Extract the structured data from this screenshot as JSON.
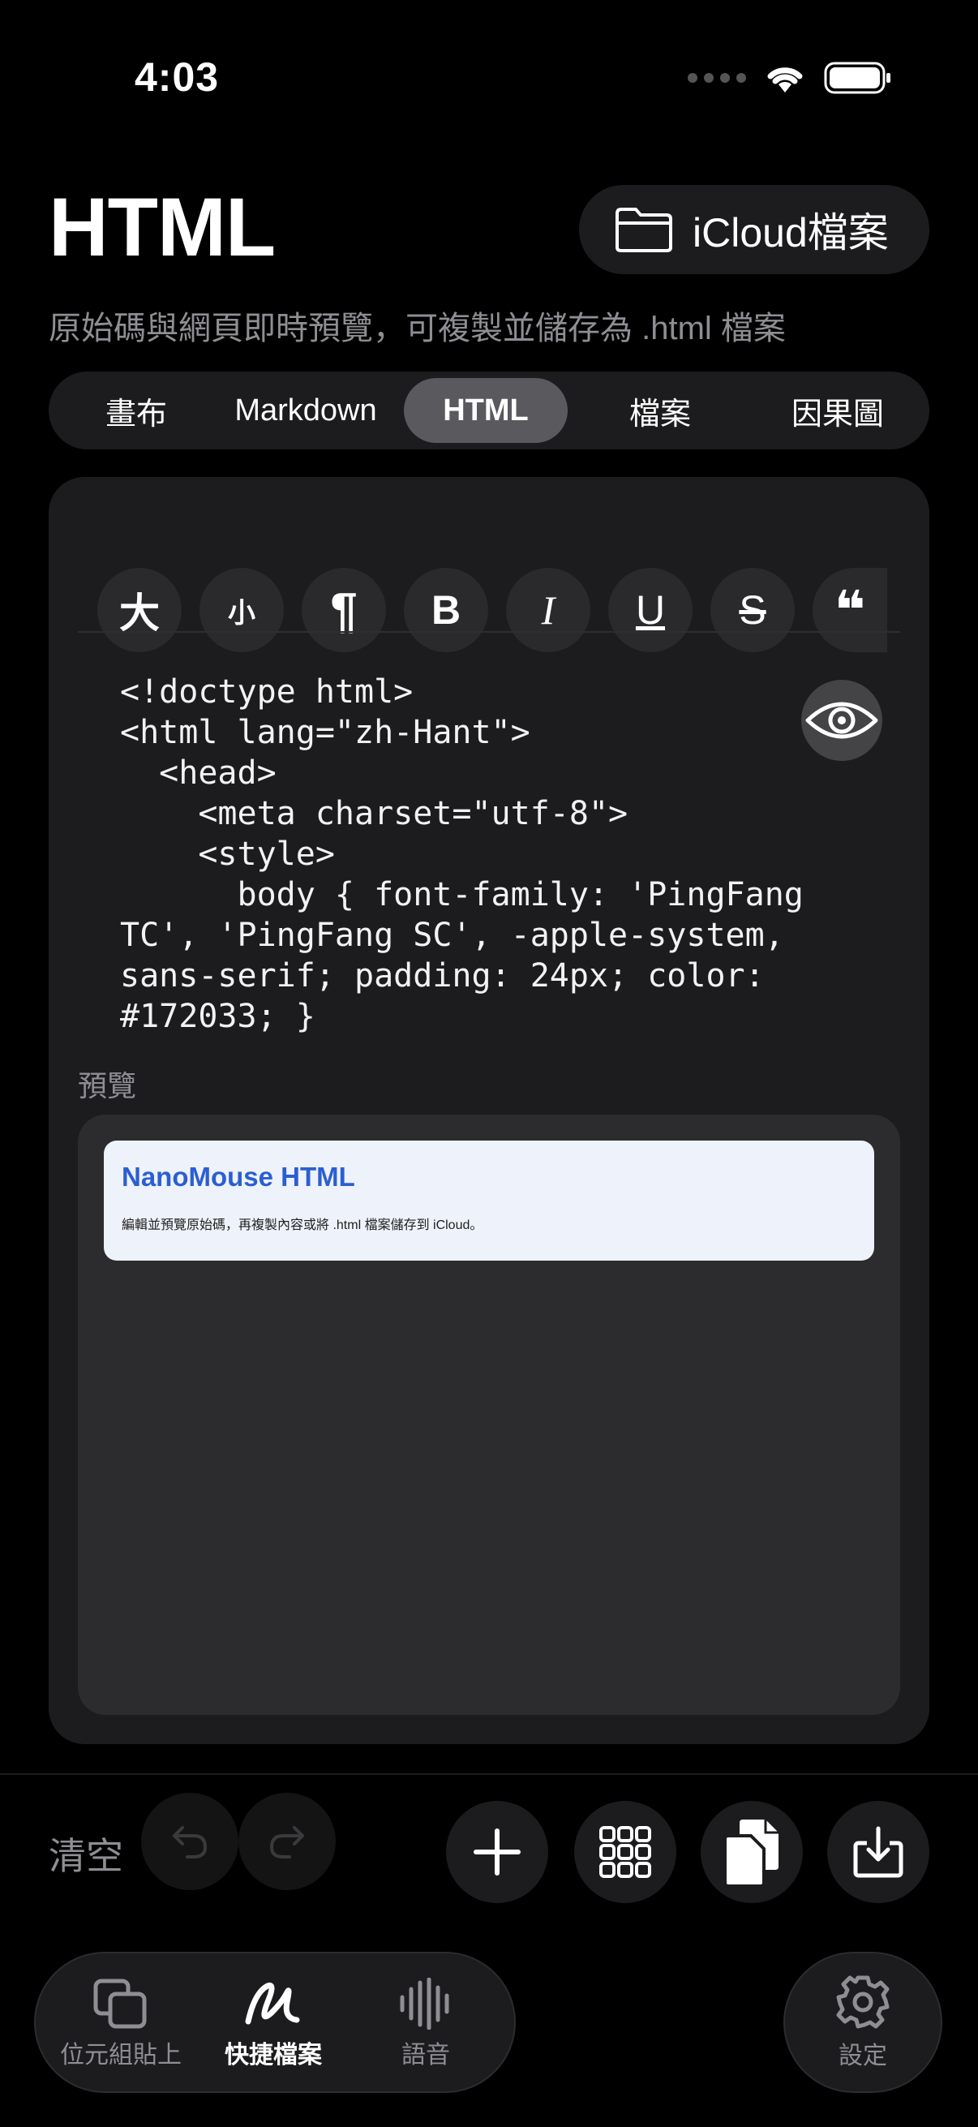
{
  "status_bar": {
    "time": "4:03"
  },
  "header": {
    "title": "HTML",
    "icloud_button": "iCloud檔案",
    "subtitle": "原始碼與網頁即時預覽，可複製並儲存為 .html 檔案"
  },
  "segmented": {
    "tabs": [
      {
        "label": "畫布",
        "active": false
      },
      {
        "label": "Markdown",
        "active": false
      },
      {
        "label": "HTML",
        "active": true
      },
      {
        "label": "檔案",
        "active": false
      },
      {
        "label": "因果圖",
        "active": false
      }
    ]
  },
  "format_toolbar": {
    "buttons": [
      "大",
      "小",
      "¶",
      "B",
      "I",
      "U",
      "S",
      "❝"
    ]
  },
  "editor": {
    "code": "<!doctype html>\n<html lang=\"zh-Hant\">\n  <head>\n    <meta charset=\"utf-8\">\n    <style>\n      body { font-family: 'PingFang\nTC', 'PingFang SC', -apple-system,\nsans-serif; padding: 24px; color:\n#172033; }"
  },
  "preview": {
    "label": "預覽",
    "heading": "NanoMouse HTML",
    "body": "編輯並預覽原始碼，再複製內容或將 .html 檔案儲存到 iCloud。"
  },
  "actions": {
    "clear_label": "清空"
  },
  "tabbar": {
    "items": [
      {
        "label": "位元組貼上",
        "icon": "copy-stack-icon",
        "active": false
      },
      {
        "label": "快捷檔案",
        "icon": "scribble-icon",
        "active": true
      },
      {
        "label": "語音",
        "icon": "waveform-icon",
        "active": false
      }
    ],
    "settings_label": "設定"
  }
}
